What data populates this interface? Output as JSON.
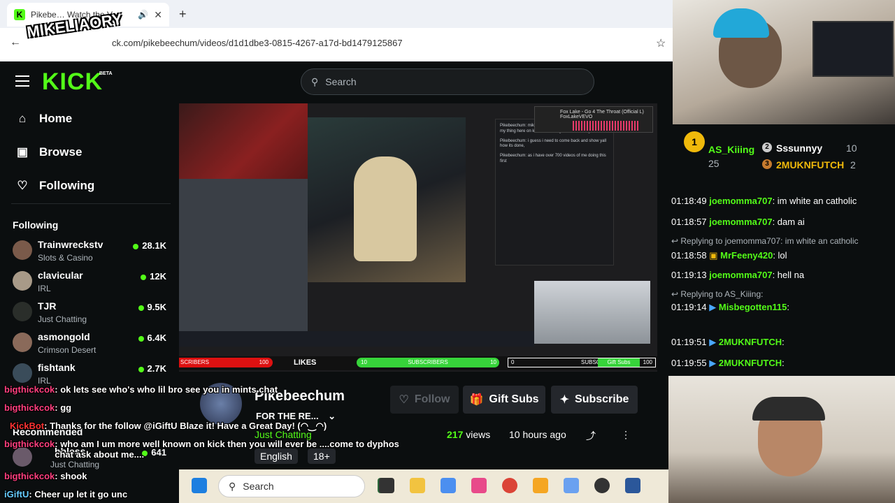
{
  "browser": {
    "tab_title": "Pikebe… Watch the V",
    "url": "ck.com/pikebeechum/videos/d1d1dbe3-0815-4267-a17d-bd1479125867"
  },
  "overlay_logo": "MIKELIAORY",
  "header": {
    "logo": "KICK",
    "beta": "BETA",
    "search_placeholder": "Search"
  },
  "sidebar": {
    "nav": [
      {
        "label": "Home",
        "icon": "home-icon"
      },
      {
        "label": "Browse",
        "icon": "browse-icon"
      },
      {
        "label": "Following",
        "icon": "heart-icon"
      }
    ],
    "following_title": "Following",
    "following": [
      {
        "name": "Trainwreckstv",
        "category": "Slots & Casino",
        "viewers": "28.1K"
      },
      {
        "name": "clavicular",
        "category": "IRL",
        "viewers": "12K"
      },
      {
        "name": "TJR",
        "category": "Just Chatting",
        "viewers": "9.5K"
      },
      {
        "name": "asmongold",
        "category": "Crimson Desert",
        "viewers": "6.4K"
      },
      {
        "name": "fishtank",
        "category": "IRL",
        "viewers": "2.7K"
      }
    ],
    "recommended_title": "Recommended",
    "recommended": [
      {
        "name": "bbless",
        "category": "Just Chatting",
        "viewers": "641"
      }
    ]
  },
  "video": {
    "music_title": "Fox Lake - Go 4 The Throat (Official L)",
    "music_sub": "FoxLakeVEVO",
    "chat_lines": [
      "Pikebeechum: mike wants to be me so bad its funny, doing my thing here on kick, and acting like he's the og hahah",
      "Pikebeechum: i guess i need to come back and show yall how its done,",
      "Pikebeechum: as i have over 700 videos of me doing this first"
    ],
    "bar": {
      "red_label": "SCRIBERS",
      "red_value": "100",
      "likes": "LIKES",
      "green_left": "10",
      "green_label": "SUBSCRIBERS",
      "green_right": "10",
      "right_left": "0",
      "right_label": "SUBSCRIBERS",
      "gift": "Gift Subs",
      "right_value": "100"
    }
  },
  "channel": {
    "name": "Pikebeechum",
    "title": "FOR THE RE...",
    "category": "Just Chatting",
    "tags": [
      "English",
      "18+"
    ],
    "follow": "Follow",
    "gift_subs": "Gift Subs",
    "subscribe": "Subscribe",
    "views_count": "217",
    "views_label": "views",
    "posted": "10 hours ago"
  },
  "chat": {
    "leaderboard": [
      {
        "rank": "1",
        "name": "AS_Kiiing",
        "count": "25"
      },
      {
        "rank": "2",
        "name": "Sssunnyy",
        "count": "10"
      },
      {
        "rank": "3",
        "name": "2MUKNFUTCH",
        "count": "2"
      }
    ],
    "messages": [
      {
        "time": "01:18:49",
        "user": "joemomma707",
        "text": ": im white an catholic",
        "color": "#53fc18"
      },
      {
        "time": "01:18:57",
        "user": "joemomma707",
        "text": ": dam ai",
        "color": "#53fc18"
      },
      {
        "reply": "Replying to joemomma707: im white an catholic"
      },
      {
        "time": "01:18:58",
        "user": "MrFeeny420",
        "text": ": lol",
        "color": "#53fc18"
      },
      {
        "time": "01:19:13",
        "user": "joemomma707",
        "text": ": hell na",
        "color": "#53fc18"
      },
      {
        "reply": "Replying to AS_Kiiing:"
      },
      {
        "time": "01:19:14",
        "user": "Misbegotten115",
        "text": ":",
        "color": "#53fc18"
      },
      {
        "time": "01:19:51",
        "user": "2MUKNFUTCH",
        "text": ":",
        "color": "#53fc18"
      },
      {
        "time": "01:19:55",
        "user": "2MUKNFUTCH",
        "text": ":",
        "color": "#53fc18"
      }
    ]
  },
  "overlay_chat": [
    {
      "user": "bigthickcok",
      "text": ": ok lets see who's who lil bro see you in mints chat"
    },
    {
      "user": "bigthickcok",
      "text": ": gg"
    },
    {
      "user": "KickBot",
      "text": ": Thanks for the follow @iGiftU Blaze it! Have a Great Day! (◠‿◠)"
    },
    {
      "user": "bigthickcok",
      "text": ": who am I um more well known on kick then you will ever be ....come to dyphos chat ask about me...."
    },
    {
      "user": "bigthickcok",
      "text": ": shook"
    },
    {
      "user": "iGiftU",
      "text": ": Cheer up let it go unc"
    }
  ],
  "taskbar": {
    "search": "Search"
  },
  "colors": {
    "kick_green": "#53fc18",
    "background": "#0b0e0f"
  }
}
